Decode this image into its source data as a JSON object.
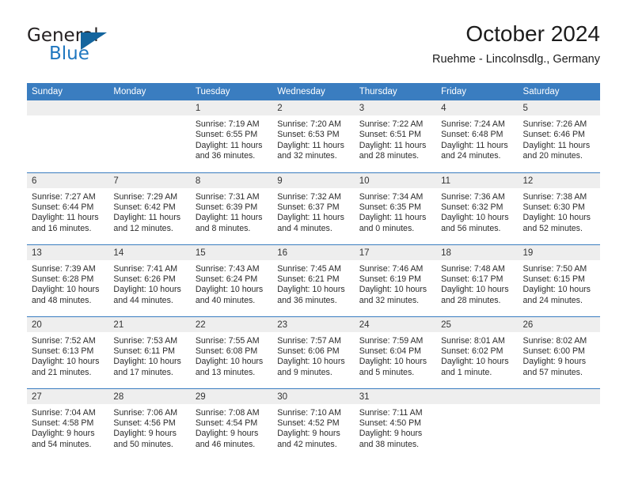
{
  "brand": {
    "word_one": "General",
    "word_two": "Blue",
    "triangle_icon": "triangle-logo-icon",
    "accent_color": "#14659e",
    "blue_text_color": "#1f77bf"
  },
  "header": {
    "title": "October 2024",
    "subtitle": "Ruehme - Lincolnsdlg., Germany"
  },
  "calendar": {
    "header_bg": "#3a7dc0",
    "daynum_bg": "#eeeeee",
    "weekday_labels": [
      "Sunday",
      "Monday",
      "Tuesday",
      "Wednesday",
      "Thursday",
      "Friday",
      "Saturday"
    ],
    "weeks": [
      [
        {
          "day": "",
          "sunrise": "",
          "sunset": "",
          "daylight_line1": "",
          "daylight_line2": ""
        },
        {
          "day": "",
          "sunrise": "",
          "sunset": "",
          "daylight_line1": "",
          "daylight_line2": ""
        },
        {
          "day": "1",
          "sunrise": "Sunrise: 7:19 AM",
          "sunset": "Sunset: 6:55 PM",
          "daylight_line1": "Daylight: 11 hours",
          "daylight_line2": "and 36 minutes."
        },
        {
          "day": "2",
          "sunrise": "Sunrise: 7:20 AM",
          "sunset": "Sunset: 6:53 PM",
          "daylight_line1": "Daylight: 11 hours",
          "daylight_line2": "and 32 minutes."
        },
        {
          "day": "3",
          "sunrise": "Sunrise: 7:22 AM",
          "sunset": "Sunset: 6:51 PM",
          "daylight_line1": "Daylight: 11 hours",
          "daylight_line2": "and 28 minutes."
        },
        {
          "day": "4",
          "sunrise": "Sunrise: 7:24 AM",
          "sunset": "Sunset: 6:48 PM",
          "daylight_line1": "Daylight: 11 hours",
          "daylight_line2": "and 24 minutes."
        },
        {
          "day": "5",
          "sunrise": "Sunrise: 7:26 AM",
          "sunset": "Sunset: 6:46 PM",
          "daylight_line1": "Daylight: 11 hours",
          "daylight_line2": "and 20 minutes."
        }
      ],
      [
        {
          "day": "6",
          "sunrise": "Sunrise: 7:27 AM",
          "sunset": "Sunset: 6:44 PM",
          "daylight_line1": "Daylight: 11 hours",
          "daylight_line2": "and 16 minutes."
        },
        {
          "day": "7",
          "sunrise": "Sunrise: 7:29 AM",
          "sunset": "Sunset: 6:42 PM",
          "daylight_line1": "Daylight: 11 hours",
          "daylight_line2": "and 12 minutes."
        },
        {
          "day": "8",
          "sunrise": "Sunrise: 7:31 AM",
          "sunset": "Sunset: 6:39 PM",
          "daylight_line1": "Daylight: 11 hours",
          "daylight_line2": "and 8 minutes."
        },
        {
          "day": "9",
          "sunrise": "Sunrise: 7:32 AM",
          "sunset": "Sunset: 6:37 PM",
          "daylight_line1": "Daylight: 11 hours",
          "daylight_line2": "and 4 minutes."
        },
        {
          "day": "10",
          "sunrise": "Sunrise: 7:34 AM",
          "sunset": "Sunset: 6:35 PM",
          "daylight_line1": "Daylight: 11 hours",
          "daylight_line2": "and 0 minutes."
        },
        {
          "day": "11",
          "sunrise": "Sunrise: 7:36 AM",
          "sunset": "Sunset: 6:32 PM",
          "daylight_line1": "Daylight: 10 hours",
          "daylight_line2": "and 56 minutes."
        },
        {
          "day": "12",
          "sunrise": "Sunrise: 7:38 AM",
          "sunset": "Sunset: 6:30 PM",
          "daylight_line1": "Daylight: 10 hours",
          "daylight_line2": "and 52 minutes."
        }
      ],
      [
        {
          "day": "13",
          "sunrise": "Sunrise: 7:39 AM",
          "sunset": "Sunset: 6:28 PM",
          "daylight_line1": "Daylight: 10 hours",
          "daylight_line2": "and 48 minutes."
        },
        {
          "day": "14",
          "sunrise": "Sunrise: 7:41 AM",
          "sunset": "Sunset: 6:26 PM",
          "daylight_line1": "Daylight: 10 hours",
          "daylight_line2": "and 44 minutes."
        },
        {
          "day": "15",
          "sunrise": "Sunrise: 7:43 AM",
          "sunset": "Sunset: 6:24 PM",
          "daylight_line1": "Daylight: 10 hours",
          "daylight_line2": "and 40 minutes."
        },
        {
          "day": "16",
          "sunrise": "Sunrise: 7:45 AM",
          "sunset": "Sunset: 6:21 PM",
          "daylight_line1": "Daylight: 10 hours",
          "daylight_line2": "and 36 minutes."
        },
        {
          "day": "17",
          "sunrise": "Sunrise: 7:46 AM",
          "sunset": "Sunset: 6:19 PM",
          "daylight_line1": "Daylight: 10 hours",
          "daylight_line2": "and 32 minutes."
        },
        {
          "day": "18",
          "sunrise": "Sunrise: 7:48 AM",
          "sunset": "Sunset: 6:17 PM",
          "daylight_line1": "Daylight: 10 hours",
          "daylight_line2": "and 28 minutes."
        },
        {
          "day": "19",
          "sunrise": "Sunrise: 7:50 AM",
          "sunset": "Sunset: 6:15 PM",
          "daylight_line1": "Daylight: 10 hours",
          "daylight_line2": "and 24 minutes."
        }
      ],
      [
        {
          "day": "20",
          "sunrise": "Sunrise: 7:52 AM",
          "sunset": "Sunset: 6:13 PM",
          "daylight_line1": "Daylight: 10 hours",
          "daylight_line2": "and 21 minutes."
        },
        {
          "day": "21",
          "sunrise": "Sunrise: 7:53 AM",
          "sunset": "Sunset: 6:11 PM",
          "daylight_line1": "Daylight: 10 hours",
          "daylight_line2": "and 17 minutes."
        },
        {
          "day": "22",
          "sunrise": "Sunrise: 7:55 AM",
          "sunset": "Sunset: 6:08 PM",
          "daylight_line1": "Daylight: 10 hours",
          "daylight_line2": "and 13 minutes."
        },
        {
          "day": "23",
          "sunrise": "Sunrise: 7:57 AM",
          "sunset": "Sunset: 6:06 PM",
          "daylight_line1": "Daylight: 10 hours",
          "daylight_line2": "and 9 minutes."
        },
        {
          "day": "24",
          "sunrise": "Sunrise: 7:59 AM",
          "sunset": "Sunset: 6:04 PM",
          "daylight_line1": "Daylight: 10 hours",
          "daylight_line2": "and 5 minutes."
        },
        {
          "day": "25",
          "sunrise": "Sunrise: 8:01 AM",
          "sunset": "Sunset: 6:02 PM",
          "daylight_line1": "Daylight: 10 hours",
          "daylight_line2": "and 1 minute."
        },
        {
          "day": "26",
          "sunrise": "Sunrise: 8:02 AM",
          "sunset": "Sunset: 6:00 PM",
          "daylight_line1": "Daylight: 9 hours",
          "daylight_line2": "and 57 minutes."
        }
      ],
      [
        {
          "day": "27",
          "sunrise": "Sunrise: 7:04 AM",
          "sunset": "Sunset: 4:58 PM",
          "daylight_line1": "Daylight: 9 hours",
          "daylight_line2": "and 54 minutes."
        },
        {
          "day": "28",
          "sunrise": "Sunrise: 7:06 AM",
          "sunset": "Sunset: 4:56 PM",
          "daylight_line1": "Daylight: 9 hours",
          "daylight_line2": "and 50 minutes."
        },
        {
          "day": "29",
          "sunrise": "Sunrise: 7:08 AM",
          "sunset": "Sunset: 4:54 PM",
          "daylight_line1": "Daylight: 9 hours",
          "daylight_line2": "and 46 minutes."
        },
        {
          "day": "30",
          "sunrise": "Sunrise: 7:10 AM",
          "sunset": "Sunset: 4:52 PM",
          "daylight_line1": "Daylight: 9 hours",
          "daylight_line2": "and 42 minutes."
        },
        {
          "day": "31",
          "sunrise": "Sunrise: 7:11 AM",
          "sunset": "Sunset: 4:50 PM",
          "daylight_line1": "Daylight: 9 hours",
          "daylight_line2": "and 38 minutes."
        },
        {
          "day": "",
          "sunrise": "",
          "sunset": "",
          "daylight_line1": "",
          "daylight_line2": ""
        },
        {
          "day": "",
          "sunrise": "",
          "sunset": "",
          "daylight_line1": "",
          "daylight_line2": ""
        }
      ]
    ]
  }
}
